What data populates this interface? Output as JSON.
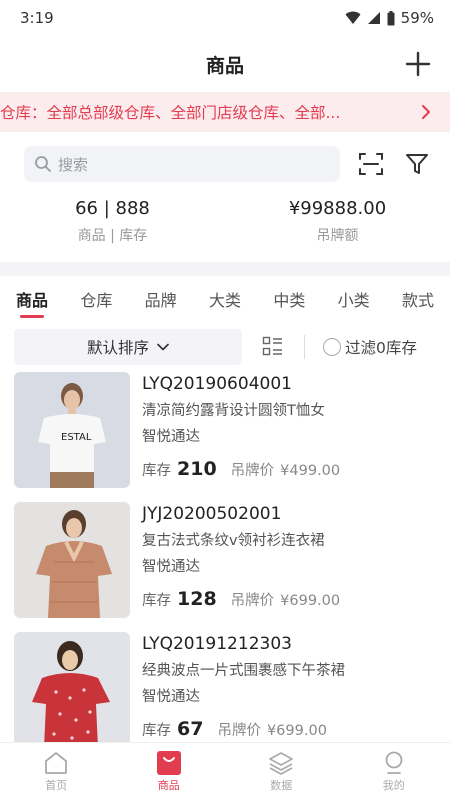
{
  "status_bar": {
    "time": "3:19",
    "battery": "59%"
  },
  "header": {
    "title": "商品"
  },
  "warehouse": {
    "text": "仓库：全部总部级仓库、全部门店级仓库、全部..."
  },
  "search": {
    "placeholder": "搜索"
  },
  "stats": {
    "count_value": "66 | 888",
    "count_label": "商品 | 库存",
    "tag_value": "¥99888.00",
    "tag_label": "吊牌额"
  },
  "tabs": [
    "商品",
    "仓库",
    "品牌",
    "大类",
    "中类",
    "小类",
    "款式"
  ],
  "sort": {
    "label": "默认排序",
    "zero_filter": "过滤0库存"
  },
  "products": [
    {
      "code": "LYQ20190604001",
      "name": "清凉简约露背设计圆领T恤女",
      "brand": "智悦通达",
      "stock_label": "库存",
      "stock": "210",
      "tag_label": "吊牌价",
      "tag_price": "¥499.00"
    },
    {
      "code": "JYJ20200502001",
      "name": "复古法式条纹v领衬衫连衣裙",
      "brand": "智悦通达",
      "stock_label": "库存",
      "stock": "128",
      "tag_label": "吊牌价",
      "tag_price": "¥699.00"
    },
    {
      "code": "LYQ20191212303",
      "name": "经典波点一片式围裹感下午茶裙",
      "brand": "智悦通达",
      "stock_label": "库存",
      "stock": "67",
      "tag_label": "吊牌价",
      "tag_price": "¥699.00"
    }
  ],
  "nav": [
    "首页",
    "商品",
    "数据",
    "我的"
  ],
  "colors": {
    "accent": "#e23c50",
    "banner_bg": "#fdecee"
  }
}
